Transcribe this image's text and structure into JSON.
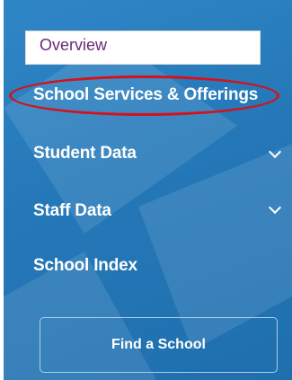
{
  "nav": {
    "overview": "Overview",
    "services": "School Services & Offerings",
    "student_data": "Student Data",
    "staff_data": "Staff Data",
    "school_index": "School Index"
  },
  "find_school": "Find a School",
  "colors": {
    "panel": "#2578b8",
    "highlight": "#d4121c",
    "overview_text": "#6b2a78"
  }
}
